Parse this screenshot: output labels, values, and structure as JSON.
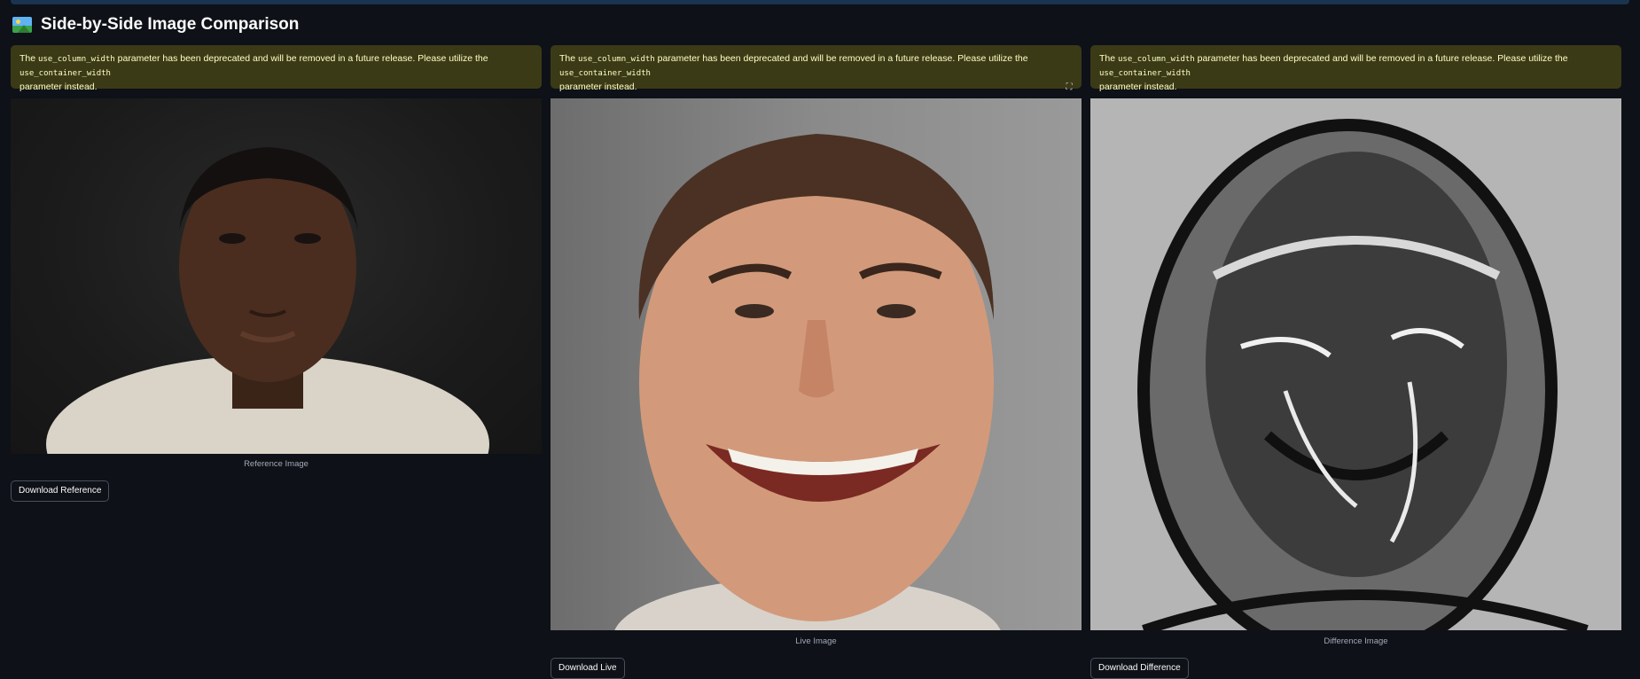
{
  "header": {
    "title": "Side-by-Side Image Comparison",
    "icon": "framed-picture-icon"
  },
  "warning": {
    "prefix": "The ",
    "code_old": "use_column_width",
    "middle": " parameter has been deprecated and will be removed in a future release. Please utilize the ",
    "code_new": "use_container_width",
    "suffix_line2": "parameter instead."
  },
  "columns": [
    {
      "caption": "Reference Image",
      "button": "Download Reference"
    },
    {
      "caption": "Live Image",
      "button": "Download Live"
    },
    {
      "caption": "Difference Image",
      "button": "Download Difference"
    }
  ],
  "colors": {
    "background": "#0e1117",
    "warning_bg": "#3b3a17",
    "warning_text": "#ffffc2"
  }
}
